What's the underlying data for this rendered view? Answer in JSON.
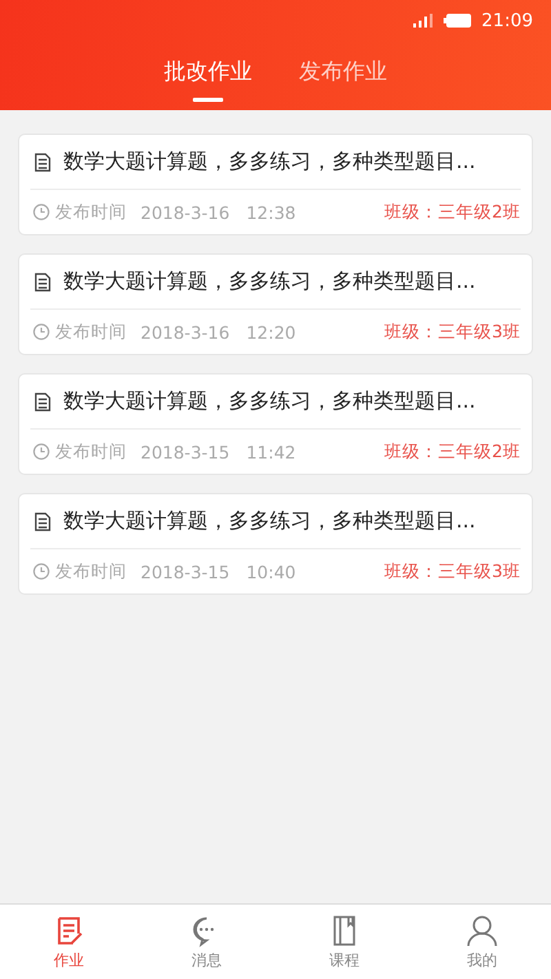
{
  "status_bar": {
    "time": "21:09"
  },
  "tabs": [
    {
      "label": "批改作业",
      "selected": true
    },
    {
      "label": "发布作业",
      "selected": false
    }
  ],
  "assignments": [
    {
      "title": "数学大题计算题，多多练习，多种类型题目...",
      "time_label": "发布时间",
      "date": "2018-3-16",
      "time": "12:38",
      "class": "班级：三年级2班"
    },
    {
      "title": "数学大题计算题，多多练习，多种类型题目...",
      "time_label": "发布时间",
      "date": "2018-3-16",
      "time": "12:20",
      "class": "班级：三年级3班"
    },
    {
      "title": "数学大题计算题，多多练习，多种类型题目...",
      "time_label": "发布时间",
      "date": "2018-3-15",
      "time": "11:42",
      "class": "班级：三年级2班"
    },
    {
      "title": "数学大题计算题，多多练习，多种类型题目...",
      "time_label": "发布时间",
      "date": "2018-3-15",
      "time": "10:40",
      "class": "班级：三年级3班"
    }
  ],
  "bottom_nav": [
    {
      "kind": "homework",
      "label": "作业",
      "selected": true
    },
    {
      "kind": "messages",
      "label": "消息",
      "selected": false
    },
    {
      "kind": "courses",
      "label": "课程",
      "selected": false
    },
    {
      "kind": "profile",
      "label": "我的",
      "selected": false
    }
  ]
}
